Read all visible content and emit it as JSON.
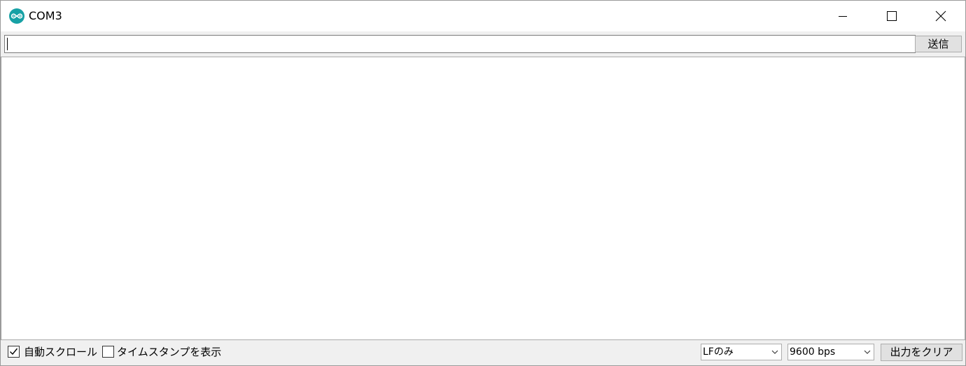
{
  "window": {
    "title": "COM3"
  },
  "send_row": {
    "input_value": "",
    "send_label": "送信"
  },
  "output": {
    "text": ""
  },
  "bottom_bar": {
    "autoscroll": {
      "label": "自動スクロール",
      "checked": true
    },
    "timestamp": {
      "label": "タイムスタンプを表示",
      "checked": false
    },
    "line_ending": {
      "selected": "LFのみ"
    },
    "baud_rate": {
      "selected": "9600 bps"
    },
    "clear_label": "出力をクリア"
  },
  "colors": {
    "accent": "#17a1a5",
    "panel": "#f0f0f0",
    "button": "#e1e1e1"
  },
  "icons": {
    "app": "arduino-icon",
    "minimize": "minimize-icon",
    "maximize": "maximize-icon",
    "close": "close-icon",
    "checkbox": "check-icon",
    "dropdown": "chevron-down-icon"
  }
}
